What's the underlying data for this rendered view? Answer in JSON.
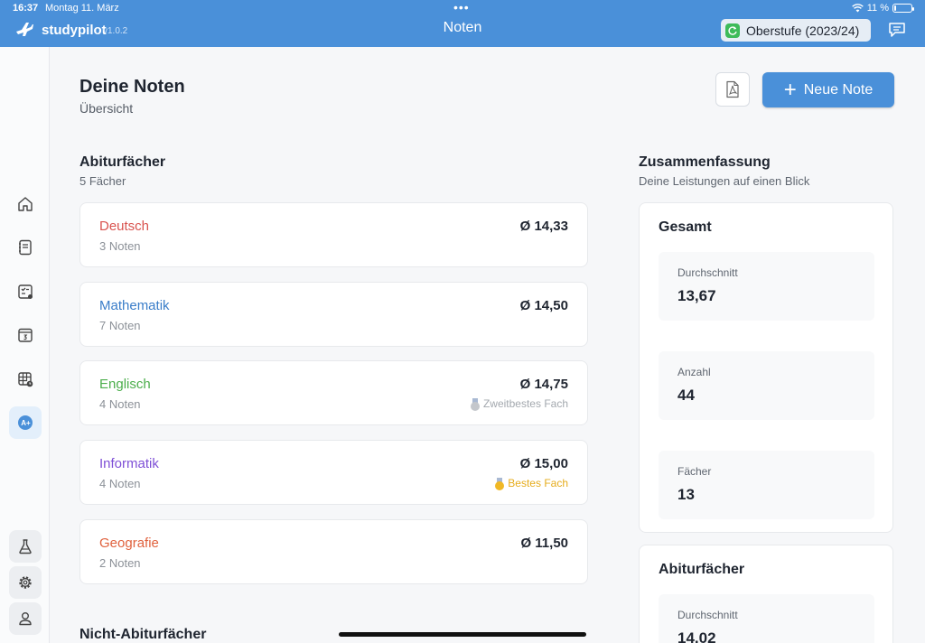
{
  "status_bar": {
    "time": "16:37",
    "date": "Montag 11. März",
    "battery_text": "11 %",
    "battery_level": 0.11
  },
  "header": {
    "app_name": "studypilot",
    "app_version": "v1.0.2",
    "title": "Noten",
    "term": "Oberstufe (2023/24)"
  },
  "page": {
    "title": "Deine Noten",
    "subtitle": "Übersicht",
    "new_grade_label": "Neue Note"
  },
  "abitur": {
    "title": "Abiturfächer",
    "count_text": "5 Fächer",
    "subjects": [
      {
        "name": "Deutsch",
        "count": "3 Noten",
        "avg": "Ø 14,33",
        "color": "#d9534f",
        "badge": ""
      },
      {
        "name": "Mathematik",
        "count": "7 Noten",
        "avg": "Ø 14,50",
        "color": "#3a7dc9",
        "badge": ""
      },
      {
        "name": "Englisch",
        "count": "4 Noten",
        "avg": "Ø 14,75",
        "color": "#4cae4c",
        "badge": "Zweitbestes Fach",
        "badge_color": "#a3a8ae"
      },
      {
        "name": "Informatik",
        "count": "4 Noten",
        "avg": "Ø 15,00",
        "color": "#7e4fd6",
        "badge": "Bestes Fach",
        "badge_color": "#e6ac1c"
      },
      {
        "name": "Geografie",
        "count": "2 Noten",
        "avg": "Ø 11,50",
        "color": "#e0623e",
        "badge": ""
      }
    ]
  },
  "non_abitur": {
    "title": "Nicht-Abiturfächer"
  },
  "summary": {
    "title": "Zusammenfassung",
    "subtitle": "Deine Leistungen auf einen Blick",
    "total": {
      "title": "Gesamt",
      "stats": [
        {
          "label": "Durchschnitt",
          "value": "13,67"
        },
        {
          "label": "Anzahl",
          "value": "44"
        },
        {
          "label": "Fächer",
          "value": "13"
        }
      ]
    },
    "abitur": {
      "title": "Abiturfächer",
      "stats": [
        {
          "label": "Durchschnitt",
          "value": "14,02"
        }
      ]
    }
  },
  "colors": {
    "accent": "#4a90d9",
    "sync_green": "#3dbb5a"
  },
  "icons": {
    "sidebar": [
      "home-icon",
      "notebook-icon",
      "tasks-icon",
      "calendar-icon",
      "timetable-icon",
      "grades-icon",
      "lab-icon",
      "settings-icon",
      "profile-icon"
    ]
  }
}
